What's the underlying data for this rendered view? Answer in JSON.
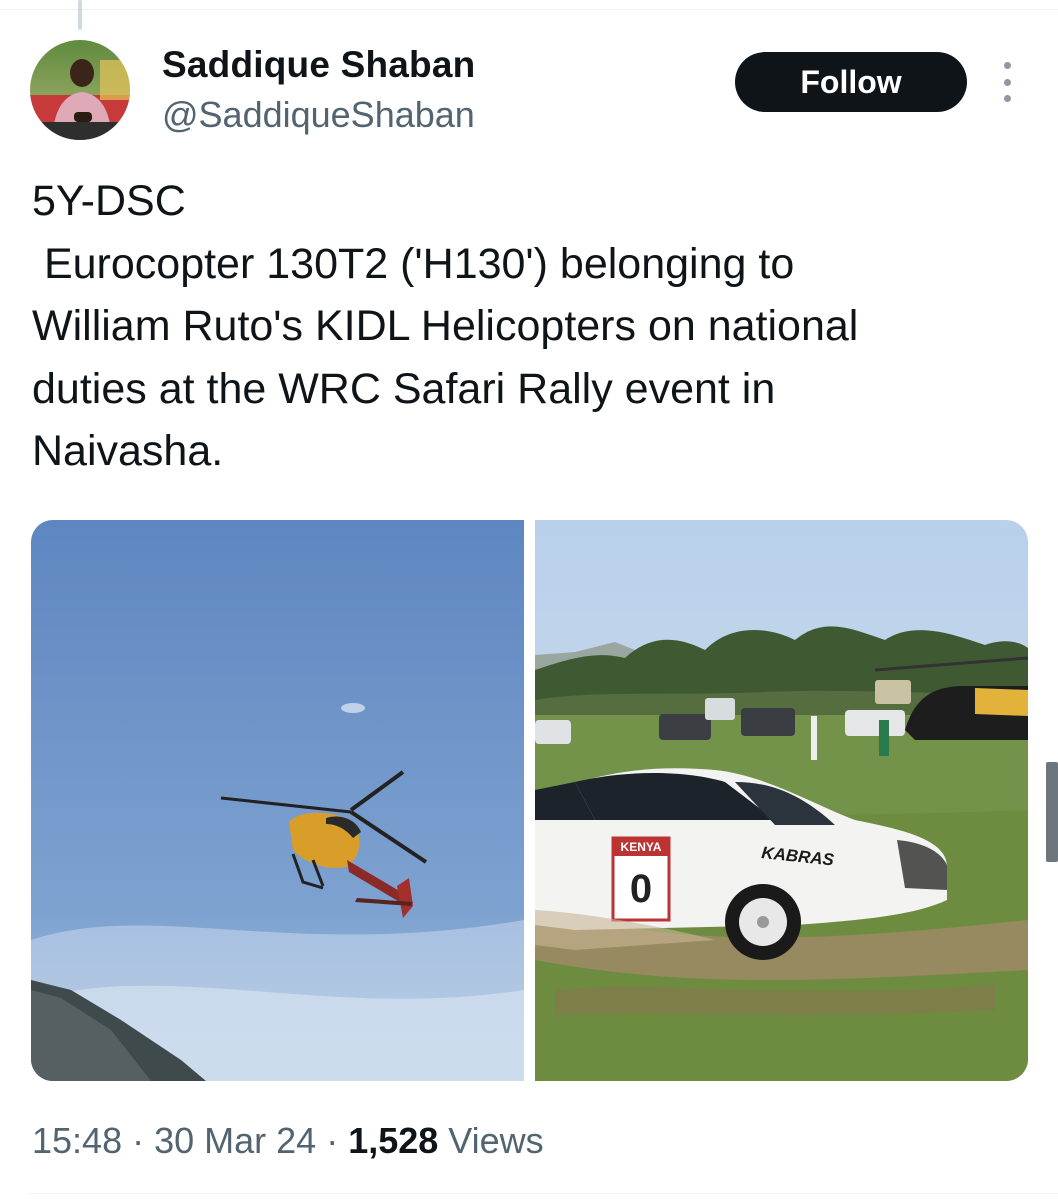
{
  "tweet": {
    "author": {
      "display_name": "Saddique Shaban",
      "handle": "@SaddiqueShaban"
    },
    "follow_label": "Follow",
    "text": "5Y-DSC\n Eurocopter 130T2 ('H130') belonging to\nWilliam Ruto's KIDL Helicopters on national\nduties at the WRC Safari Rally event in\nNaivasha.",
    "media": [
      {
        "description": "helicopter-in-sky-photo"
      },
      {
        "description": "rally-car-and-helicopter-photo",
        "car_number": "0",
        "car_plate": "KENYA",
        "car_sponsor": "KABRAS"
      }
    ],
    "meta": {
      "time": "15:48",
      "separator": " · ",
      "date": "30 Mar 24",
      "views_count": "1,528",
      "views_label": " Views"
    }
  },
  "colors": {
    "text_primary": "#0f1419",
    "text_secondary": "#536471",
    "follow_bg": "#0f1419",
    "follow_fg": "#ffffff",
    "sky": "#5d86c0"
  },
  "icons": [
    "more-options-icon"
  ]
}
